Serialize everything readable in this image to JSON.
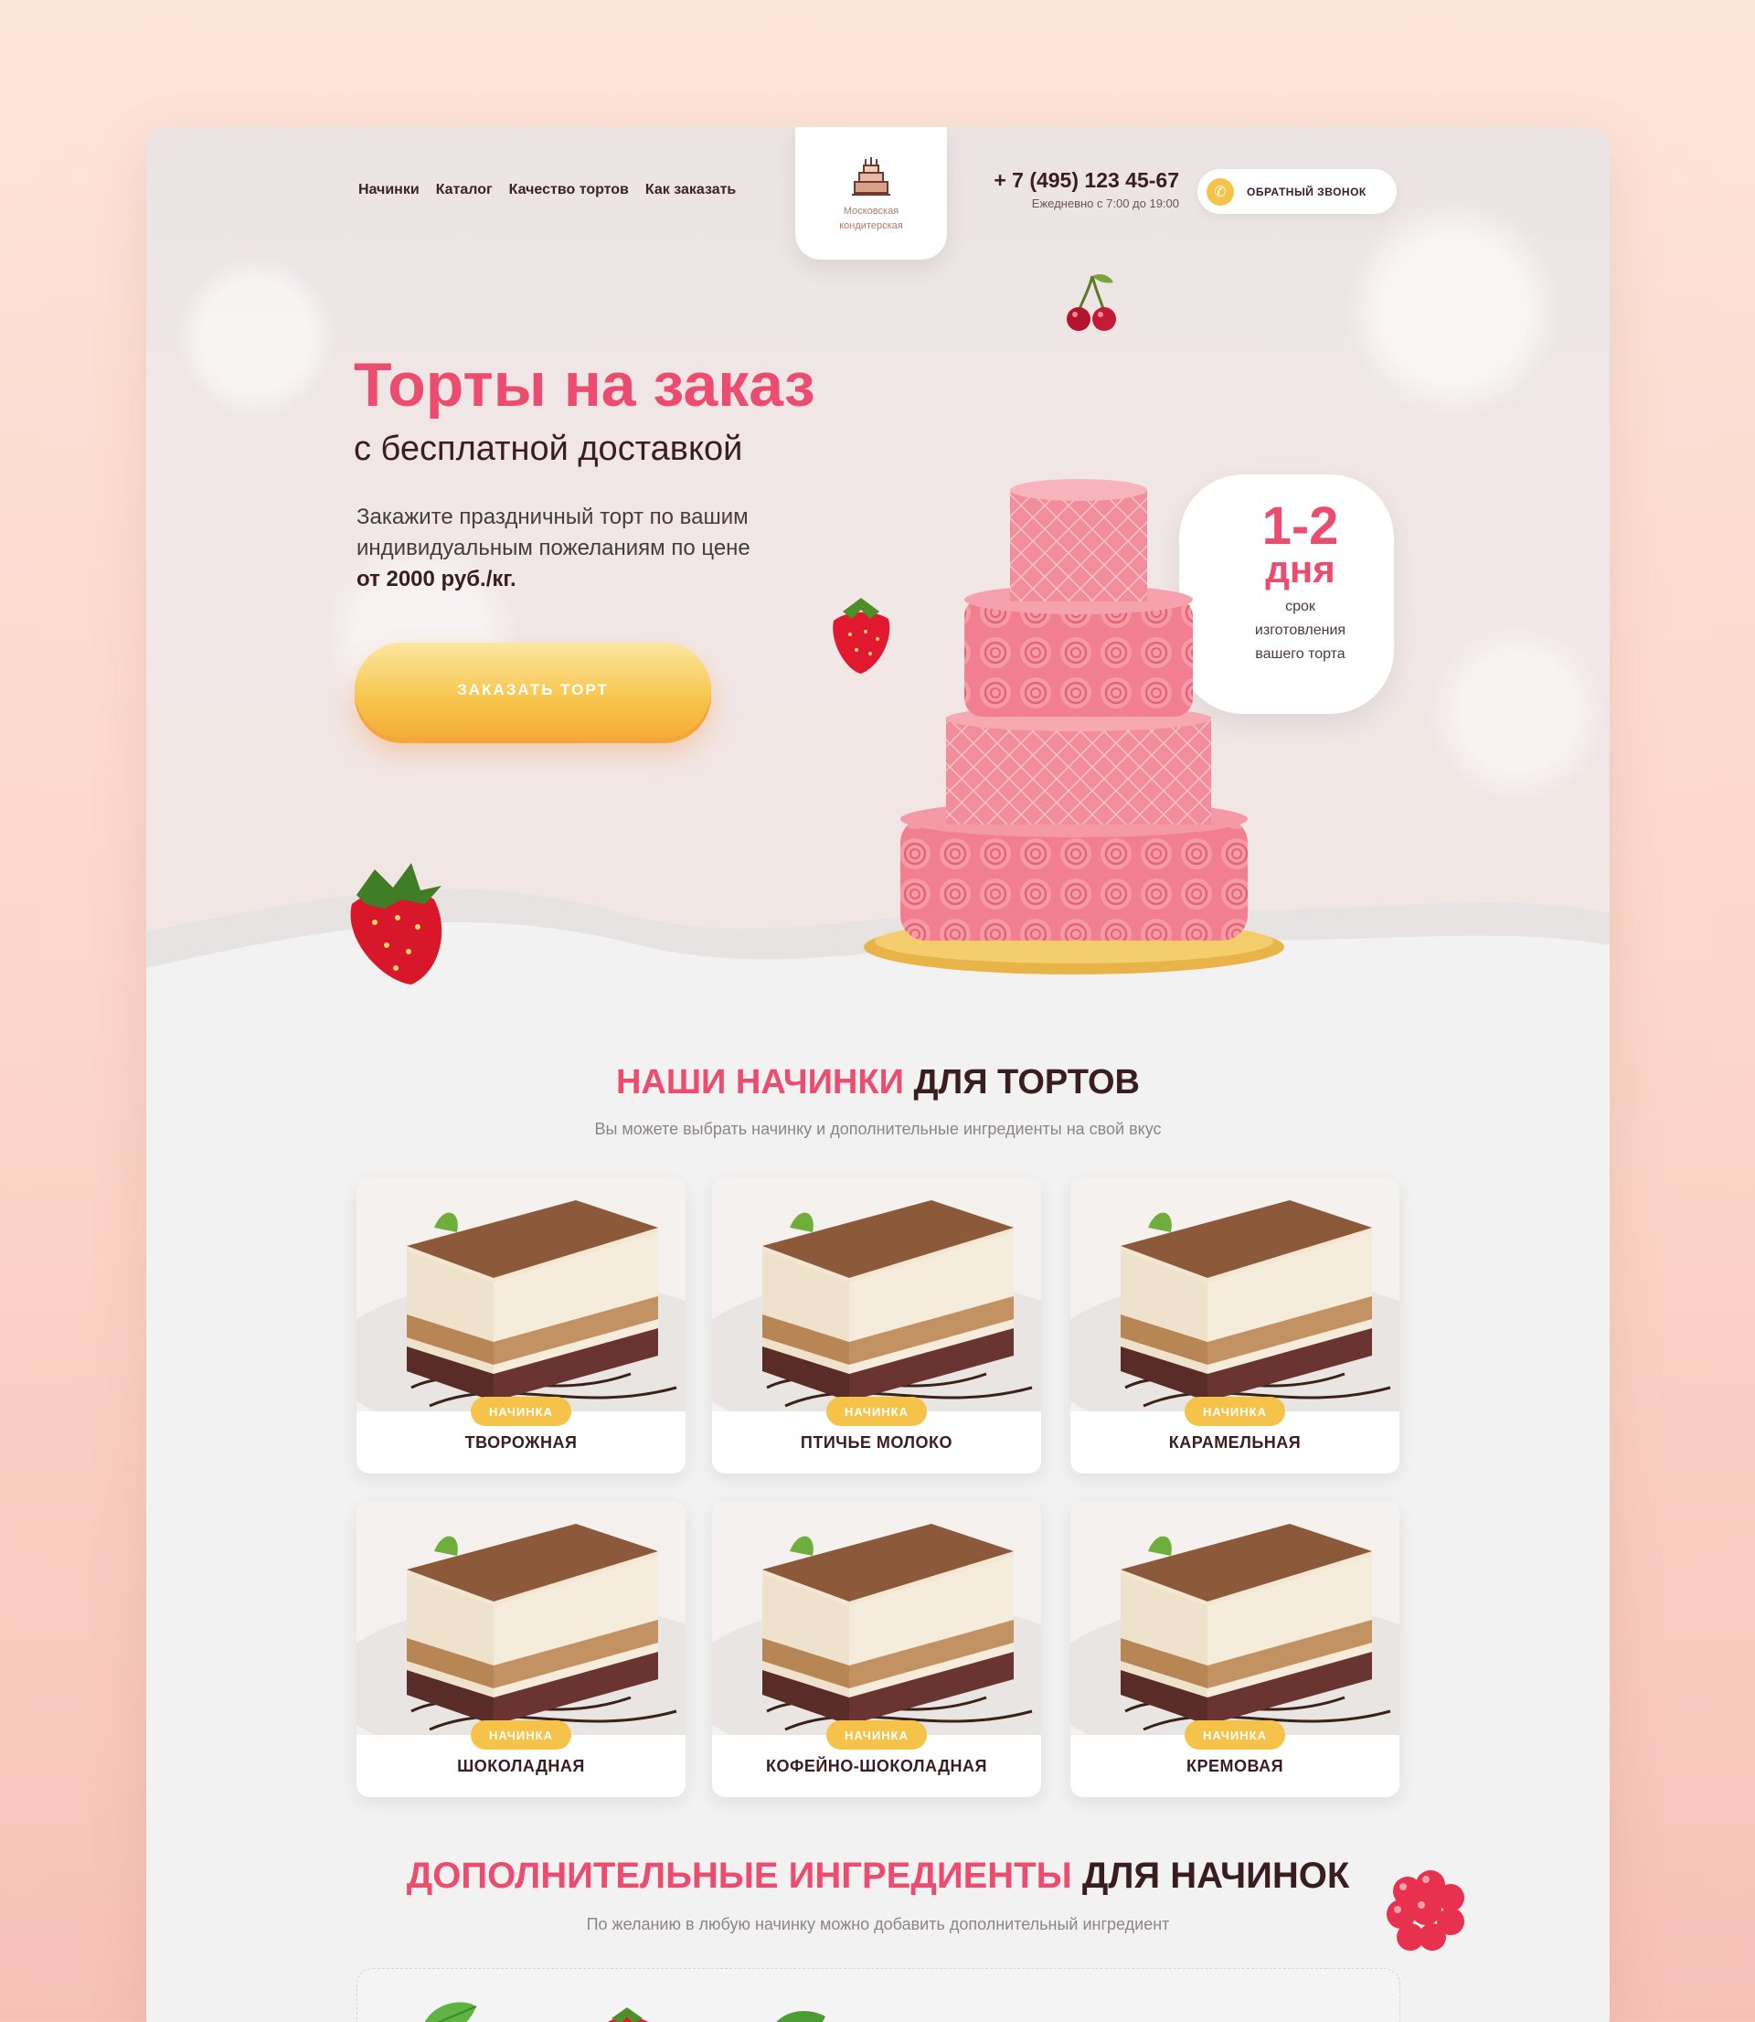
{
  "nav": {
    "links": [
      "Начинки",
      "Каталог",
      "Качество тортов",
      "Как заказать"
    ]
  },
  "logo": {
    "line1": "Московская",
    "line2": "кондитерская"
  },
  "contacts": {
    "phone": "+ 7 (495) 123 45-67",
    "hours": "Ежедневно с 7:00 до 19:00"
  },
  "callback": {
    "label": "ОБРАТНЫЙ ЗВОНОК"
  },
  "hero": {
    "title": "Торты на заказ",
    "subtitle": "с бесплатной доставкой",
    "desc_line1": "Закажите праздничный торт по вашим",
    "desc_line2": "индивидуальным пожеланиям по цене",
    "desc_price": "от 2000 руб./кг.",
    "button": "ЗАКАЗАТЬ ТОРТ"
  },
  "badge": {
    "big": "1-2",
    "unit": "дня",
    "line1": "срок",
    "line2": "изготовления",
    "line3": "вашего торта"
  },
  "fillings": {
    "title_accent": "НАШИ НАЧИНКИ",
    "title_rest": "ДЛЯ ТОРТОВ",
    "subtitle": "Вы можете выбрать начинку и дополнительные ингредиенты на свой вкус",
    "tag": "НАЧИНКА",
    "items": [
      "ТВОРОЖНАЯ",
      "ПТИЧЬЕ МОЛОКО",
      "КАРАМЕЛЬНАЯ",
      "ШОКОЛАДНАЯ",
      "КОФЕЙНО-ШОКОЛАДНАЯ",
      "КРЕМОВАЯ"
    ]
  },
  "extras": {
    "title_accent": "ДОПОЛНИТЕЛЬНЫЕ ИНГРЕДИЕНТЫ",
    "title_rest": "ДЛЯ НАЧИНОК",
    "subtitle": "По желанию в любую начинку можно добавить дополнительный ингредиент"
  },
  "colors": {
    "accent": "#ec4d6f",
    "brand_dark": "#3a1d20",
    "yellow": "#f6c34a"
  }
}
